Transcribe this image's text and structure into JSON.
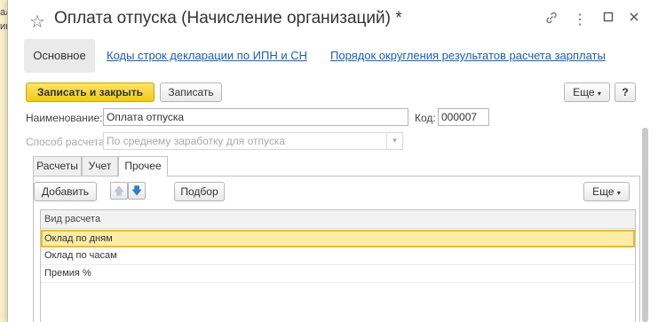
{
  "background": {
    "left_text_top": "ал",
    "left_text_mid": "инд"
  },
  "window": {
    "title": "Оплата отпуска (Начисление организаций) *",
    "favorite_icon": "star-icon",
    "link_icon": "link-icon",
    "menu_icon": "more-vertical-icon",
    "maximize_icon": "maximize-icon",
    "close_icon": "close-icon"
  },
  "nav": {
    "main": "Основное",
    "links": [
      "Коды строк декларации по ИПН и СН",
      "Порядок округления результатов расчета зарплаты"
    ]
  },
  "toolbar": {
    "save_close": "Записать и закрыть",
    "save": "Записать",
    "more": "Еще",
    "help": "?"
  },
  "form": {
    "name_label": "Наименование:",
    "name_value": "Оплата отпуска",
    "code_label": "Код:",
    "code_value": "000007",
    "method_label": "Способ расчета:",
    "method_value": "По среднему заработку для отпуска"
  },
  "tabs": [
    "Расчеты",
    "Учет",
    "Прочее"
  ],
  "panel": {
    "add": "Добавить",
    "select": "Подбор",
    "more": "Еще",
    "up_icon": "arrow-up-icon",
    "down_icon": "arrow-down-icon"
  },
  "table": {
    "header": "Вид расчета",
    "rows": [
      "Оклад по дням",
      "Оклад по часам",
      "Премия %"
    ]
  },
  "colors": {
    "accent_yellow": "#f5d327",
    "link_blue": "#1a5fb4",
    "selection": "#fbeca6"
  }
}
